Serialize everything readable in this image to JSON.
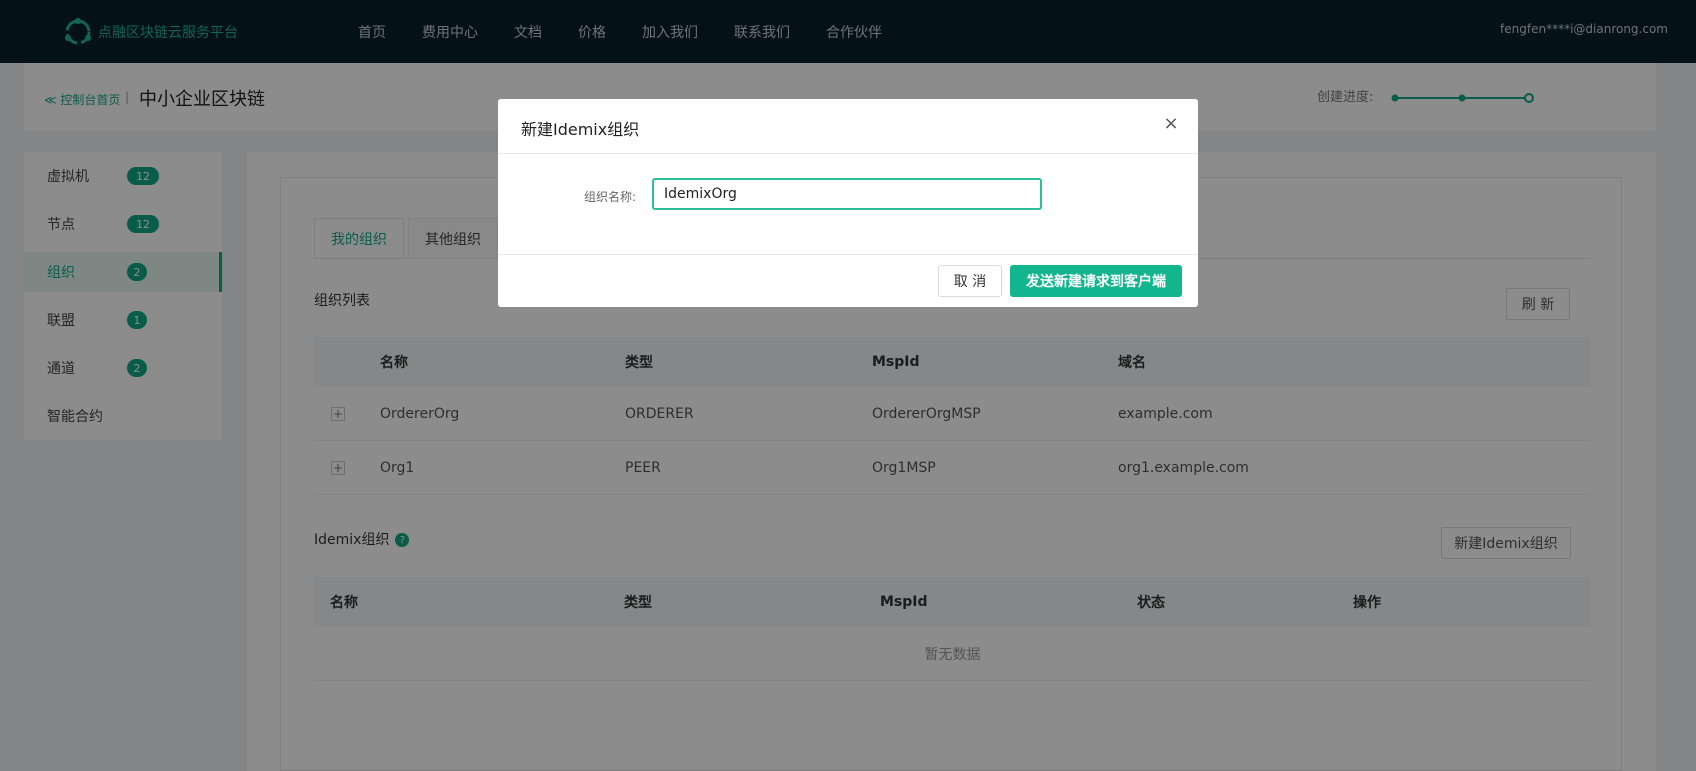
{
  "topnav": {
    "brand": "点融区块链云服务平台",
    "items": [
      "首页",
      "费用中心",
      "文档",
      "价格",
      "加入我们",
      "联系我们",
      "合作伙伴"
    ],
    "user": "fengfen****i@dianrong.com"
  },
  "breadcrumb": {
    "back": "≪ 控制台首页",
    "sep": "|",
    "title": "中小企业区块链",
    "progress_label": "创建进度:"
  },
  "sidebar": {
    "items": [
      {
        "label": "虚拟机",
        "count": "12"
      },
      {
        "label": "节点",
        "count": "12"
      },
      {
        "label": "组织",
        "count": "2"
      },
      {
        "label": "联盟",
        "count": "1"
      },
      {
        "label": "通道",
        "count": "2"
      },
      {
        "label": "智能合约",
        "count": ""
      }
    ],
    "active_index": 2
  },
  "tabs": [
    "我的组织",
    "其他组织"
  ],
  "org_list": {
    "title": "组织列表",
    "refresh": "刷 新",
    "headers": [
      "名称",
      "类型",
      "MspId",
      "域名"
    ],
    "rows": [
      {
        "expand": "+",
        "name": "OrdererOrg",
        "type": "ORDERER",
        "mspid": "OrdererOrgMSP",
        "domain": "example.com"
      },
      {
        "expand": "+",
        "name": "Org1",
        "type": "PEER",
        "mspid": "Org1MSP",
        "domain": "org1.example.com"
      }
    ]
  },
  "idemix": {
    "title": "Idemix组织",
    "help": "?",
    "new_button": "新建Idemix组织",
    "headers": [
      "名称",
      "类型",
      "MspId",
      "状态",
      "操作"
    ],
    "empty": "暂无数据"
  },
  "modal": {
    "title": "新建Idemix组织",
    "close": "×",
    "field_label": "组织名称:",
    "field_value": "IdemixOrg",
    "cancel": "取 消",
    "submit": "发送新建请求到客户端"
  },
  "colors": {
    "accent": "#12a887",
    "topbar": "#0a1f2e"
  }
}
